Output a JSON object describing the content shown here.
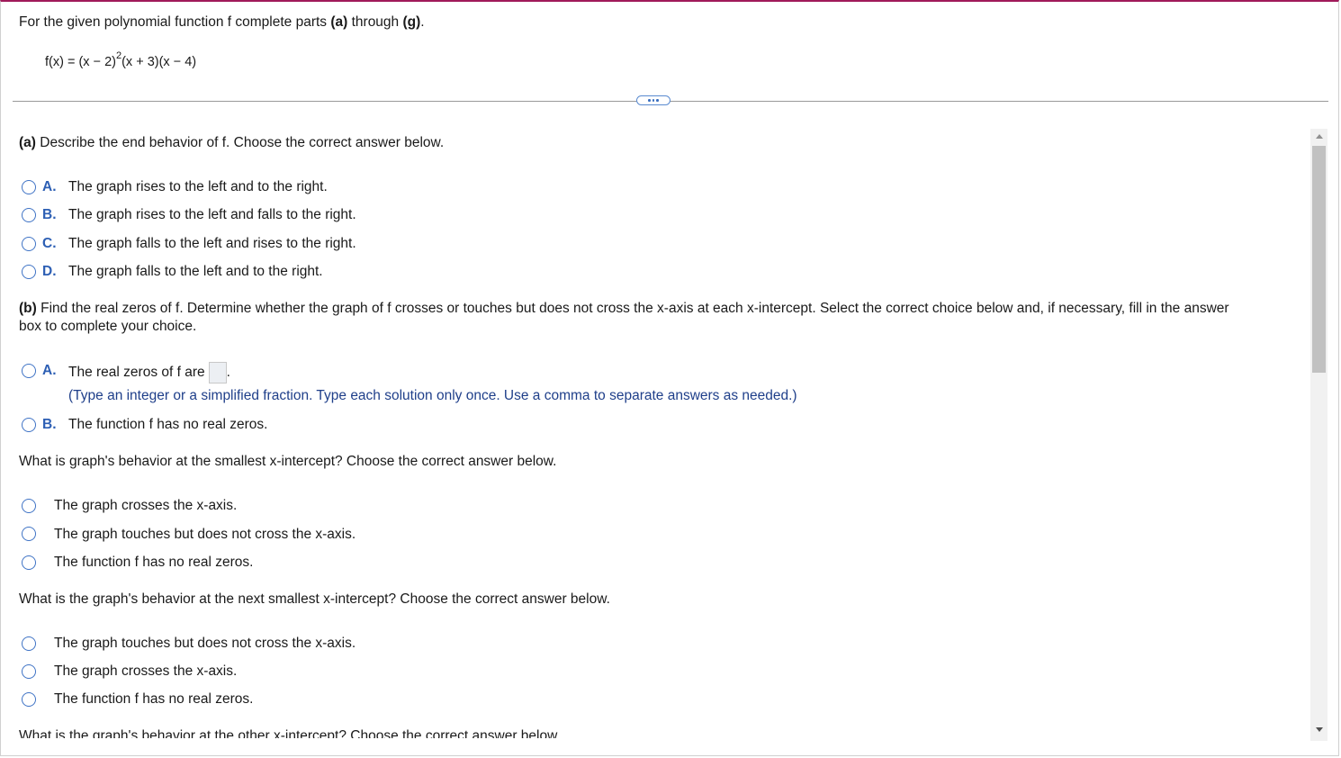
{
  "header": {
    "intro_pre": "For the given polynomial function f complete parts ",
    "intro_a": "(a)",
    "intro_mid": " through ",
    "intro_g": "(g)",
    "intro_end": ".",
    "eq_pre": "f(x) = (x − 2)",
    "eq_exp": "2",
    "eq_post": "(x + 3)(x − 4)"
  },
  "part_a": {
    "tag": "(a)",
    "prompt": " Describe the end behavior of f. Choose the correct answer below.",
    "options": [
      {
        "letter": "A.",
        "text": "The graph rises to the left and to the right."
      },
      {
        "letter": "B.",
        "text": "The graph rises to the left and falls to the right."
      },
      {
        "letter": "C.",
        "text": "The graph falls to the left and rises to the right."
      },
      {
        "letter": "D.",
        "text": "The graph falls to the left and to the right."
      }
    ]
  },
  "part_b": {
    "tag": "(b)",
    "prompt_line1": " Find the real zeros of f. Determine whether the graph of f crosses or touches but does not cross the x-axis at each x-intercept. Select the correct choice below and, if necessary, fill in the answer",
    "prompt_line2": "box to complete your choice.",
    "option_a_letter": "A.",
    "option_a_text": "The real zeros of f are",
    "option_a_hint": "(Type an integer or a simplified fraction. Type each solution only once. Use a comma to separate answers as needed.)",
    "option_b_letter": "B.",
    "option_b_text": "The function f has no real zeros."
  },
  "q_smallest": {
    "prompt": "What is graph's behavior at the smallest x-intercept? Choose the correct answer below.",
    "options": [
      "The graph crosses the x-axis.",
      "The graph touches but does not cross the x-axis.",
      "The function f has no real zeros."
    ]
  },
  "q_next": {
    "prompt": "What is the graph's behavior at the next smallest x-intercept? Choose the correct answer below.",
    "options": [
      "The graph touches but does not cross the x-axis.",
      "The graph crosses the x-axis.",
      "The function f has no real zeros."
    ]
  },
  "q_other": {
    "prompt": "What is the graph's behavior at the other x-intercept? Choose the correct answer below."
  },
  "colors": {
    "accent_top": "#a01a5a",
    "radio_border": "#3f73c5",
    "letter": "#2d5fb4",
    "hint": "#1f3f8a"
  }
}
